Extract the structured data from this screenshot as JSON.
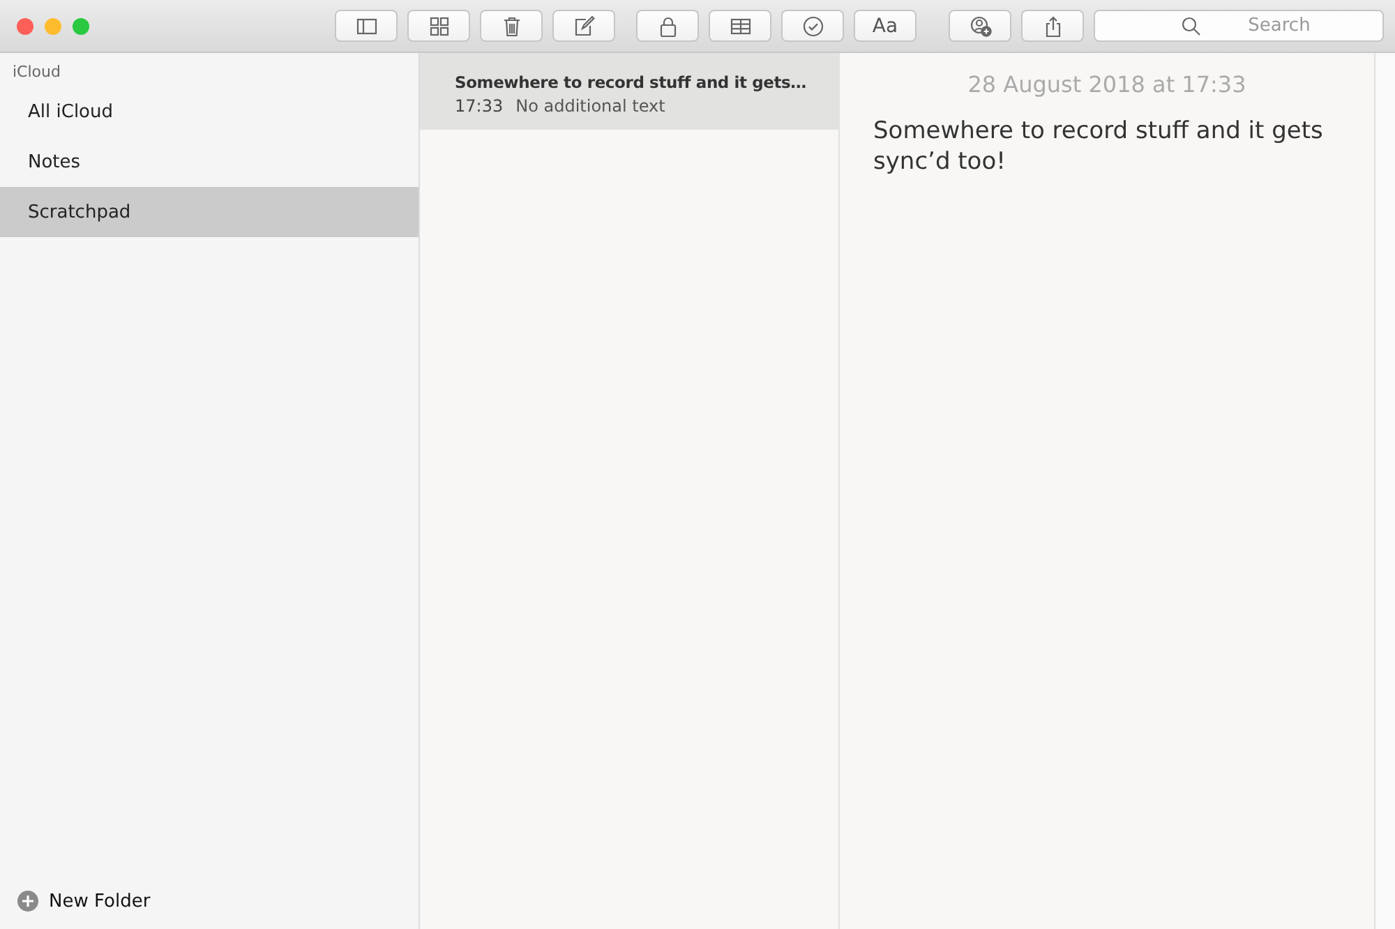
{
  "toolbar": {
    "format_label": "Aa",
    "search": {
      "placeholder": "Search"
    }
  },
  "sidebar": {
    "account": "iCloud",
    "folders": [
      {
        "name": "All iCloud",
        "selected": false
      },
      {
        "name": "Notes",
        "selected": false
      },
      {
        "name": "Scratchpad",
        "selected": true
      }
    ],
    "new_folder": "New Folder"
  },
  "notes": [
    {
      "title": "Somewhere to record stuff and it gets…",
      "time": "17:33",
      "preview": "No additional text",
      "selected": true
    }
  ],
  "editor": {
    "date": "28 August 2018 at 17:33",
    "body": "Somewhere to record stuff and it gets sync’d too!"
  }
}
